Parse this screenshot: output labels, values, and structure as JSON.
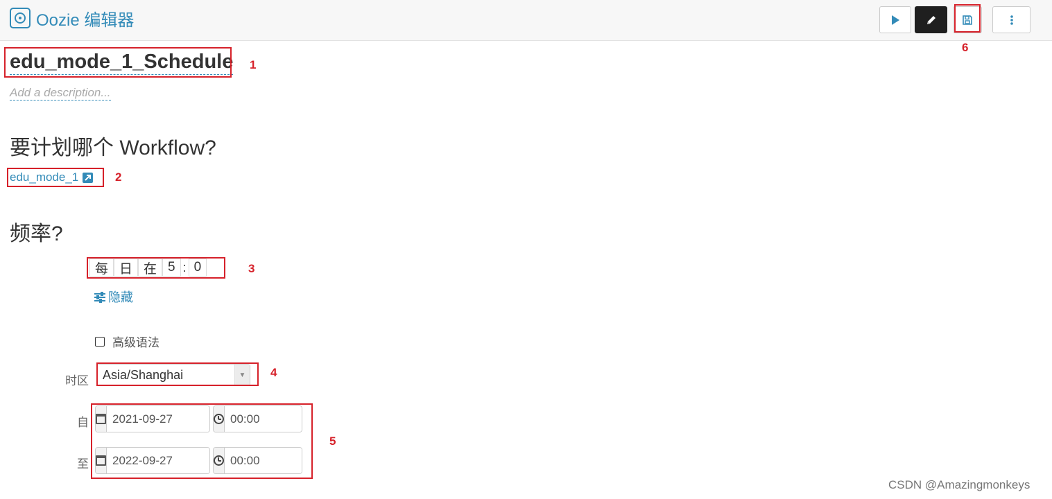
{
  "header": {
    "app_title": "Oozie 编辑器",
    "app_icon": "oozie-target-icon",
    "buttons": [
      {
        "icon": "play-icon"
      },
      {
        "icon": "pencil-icon"
      },
      {
        "icon": "save-icon"
      },
      {
        "icon": "more-vertical-icon"
      }
    ]
  },
  "coordinator": {
    "name": "edu_mode_1_Schedule",
    "description_placeholder": "Add a description..."
  },
  "workflow_section": {
    "heading": "要计划哪个 Workflow?",
    "workflow_link": "edu_mode_1"
  },
  "frequency_section": {
    "heading": "频率?",
    "cells": [
      "每",
      "日",
      "在",
      "5",
      ":",
      "0"
    ],
    "hide_label": "隐藏",
    "advanced_syntax_label": "高级语法",
    "advanced_syntax_checked": false
  },
  "timezone": {
    "label": "时区",
    "value": "Asia/Shanghai"
  },
  "start": {
    "label": "自",
    "date": "2021-09-27",
    "time": "00:00"
  },
  "end": {
    "label": "至",
    "date": "2022-09-27",
    "time": "00:00"
  },
  "annotations": [
    "1",
    "2",
    "3",
    "4",
    "5",
    "6"
  ],
  "watermark": "CSDN @Amazingmonkeys",
  "colors": {
    "accent": "#338bb8",
    "annotation_red": "#d6212a",
    "dark_button": "#1f1f1f"
  }
}
